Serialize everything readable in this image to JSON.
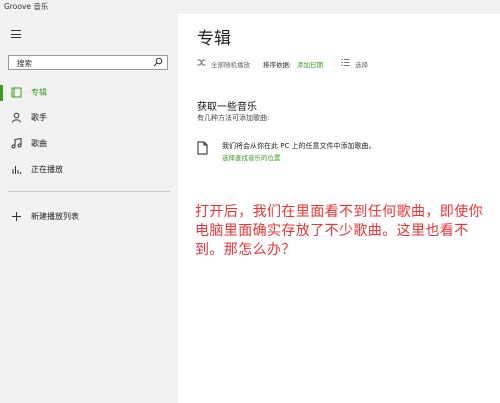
{
  "window": {
    "title": "Groove 音乐"
  },
  "sidebar": {
    "search_placeholder": "搜索",
    "nav": [
      {
        "label": "专辑",
        "icon": "album-icon",
        "active": true
      },
      {
        "label": "歌手",
        "icon": "person-icon",
        "active": false
      },
      {
        "label": "歌曲",
        "icon": "music-note-icon",
        "active": false
      },
      {
        "label": "正在播放",
        "icon": "equalizer-icon",
        "active": false
      }
    ],
    "new_playlist": "新建播放列表"
  },
  "main": {
    "title": "专辑",
    "toolbar": {
      "shuffle": "全部随机播放",
      "sort_label": "排序依据:",
      "sort_value": "添加日期",
      "select": "选择"
    },
    "empty": {
      "heading": "获取一些音乐",
      "subheading": "有几种方法可添加歌曲:",
      "folder_text": "我们将会从你在此 PC 上的任意文件中添加歌曲。",
      "folder_link": "选择查找音乐的位置"
    }
  },
  "annotation": {
    "text": "打开后，我们在里面看不到任何歌曲，即使你电脑里面确实存放了不少歌曲。这里也看不到。那怎么办？",
    "color": "#ee3333"
  },
  "colors": {
    "accent": "#3c9c1f",
    "sidebar_bg": "#f2f2f2"
  }
}
